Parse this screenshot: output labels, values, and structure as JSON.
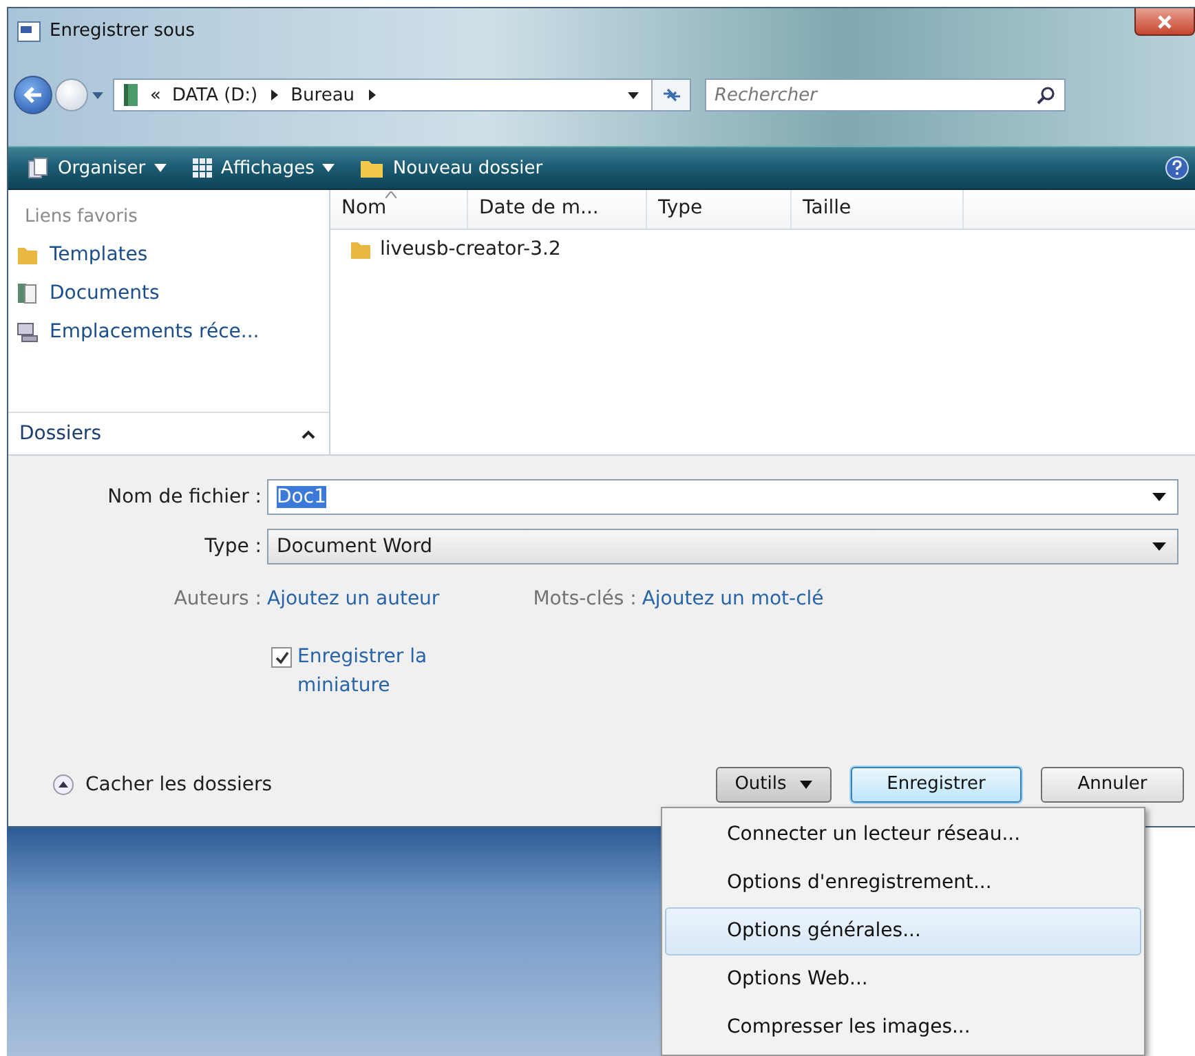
{
  "window": {
    "title": "Enregistrer sous"
  },
  "address_bar": {
    "overflow": "«",
    "breadcrumbs": [
      "DATA (D:)",
      "Bureau"
    ]
  },
  "search": {
    "placeholder": "Rechercher"
  },
  "toolbar": [
    {
      "label": "Organiser",
      "dropdown": true
    },
    {
      "label": "Affichages",
      "dropdown": true
    },
    {
      "label": "Nouveau dossier",
      "dropdown": false
    }
  ],
  "sidebar": {
    "heading": "Liens favoris",
    "items": [
      {
        "label": "Templates"
      },
      {
        "label": "Documents"
      },
      {
        "label": "Emplacements réce..."
      }
    ],
    "folders_label": "Dossiers"
  },
  "table": {
    "columns": [
      {
        "label": "Nom",
        "sorted": true
      },
      {
        "label": "Date de m...",
        "sorted": false
      },
      {
        "label": "Type",
        "sorted": false
      },
      {
        "label": "Taille",
        "sorted": false
      }
    ],
    "rows": [
      {
        "name": "liveusb-creator-3.2"
      }
    ]
  },
  "form": {
    "filename": {
      "label": "Nom de fichier :",
      "value": "Doc1",
      "selected": true
    },
    "type": {
      "label": "Type :",
      "value": "Document Word"
    },
    "authors": {
      "label": "Auteurs :",
      "value": "Ajoutez un auteur"
    },
    "keywords": {
      "label": "Mots-clés :",
      "value": "Ajoutez un mot-clé"
    },
    "thumbnail": {
      "label": "Enregistrer la miniature",
      "checked": true
    }
  },
  "footer": {
    "toggle": "Cacher les dossiers",
    "buttons": [
      {
        "label": "Outils",
        "kind": "dropdown"
      },
      {
        "label": "Enregistrer",
        "kind": "default"
      },
      {
        "label": "Annuler",
        "kind": "normal"
      }
    ]
  },
  "menu": {
    "items": [
      {
        "label": "Connecter un lecteur réseau...",
        "selected": false
      },
      {
        "label": "Options d'enregistrement...",
        "selected": false
      },
      {
        "label": "Options générales...",
        "selected": true
      },
      {
        "label": "Options Web...",
        "selected": false
      },
      {
        "label": "Compresser les images...",
        "selected": false
      }
    ]
  }
}
